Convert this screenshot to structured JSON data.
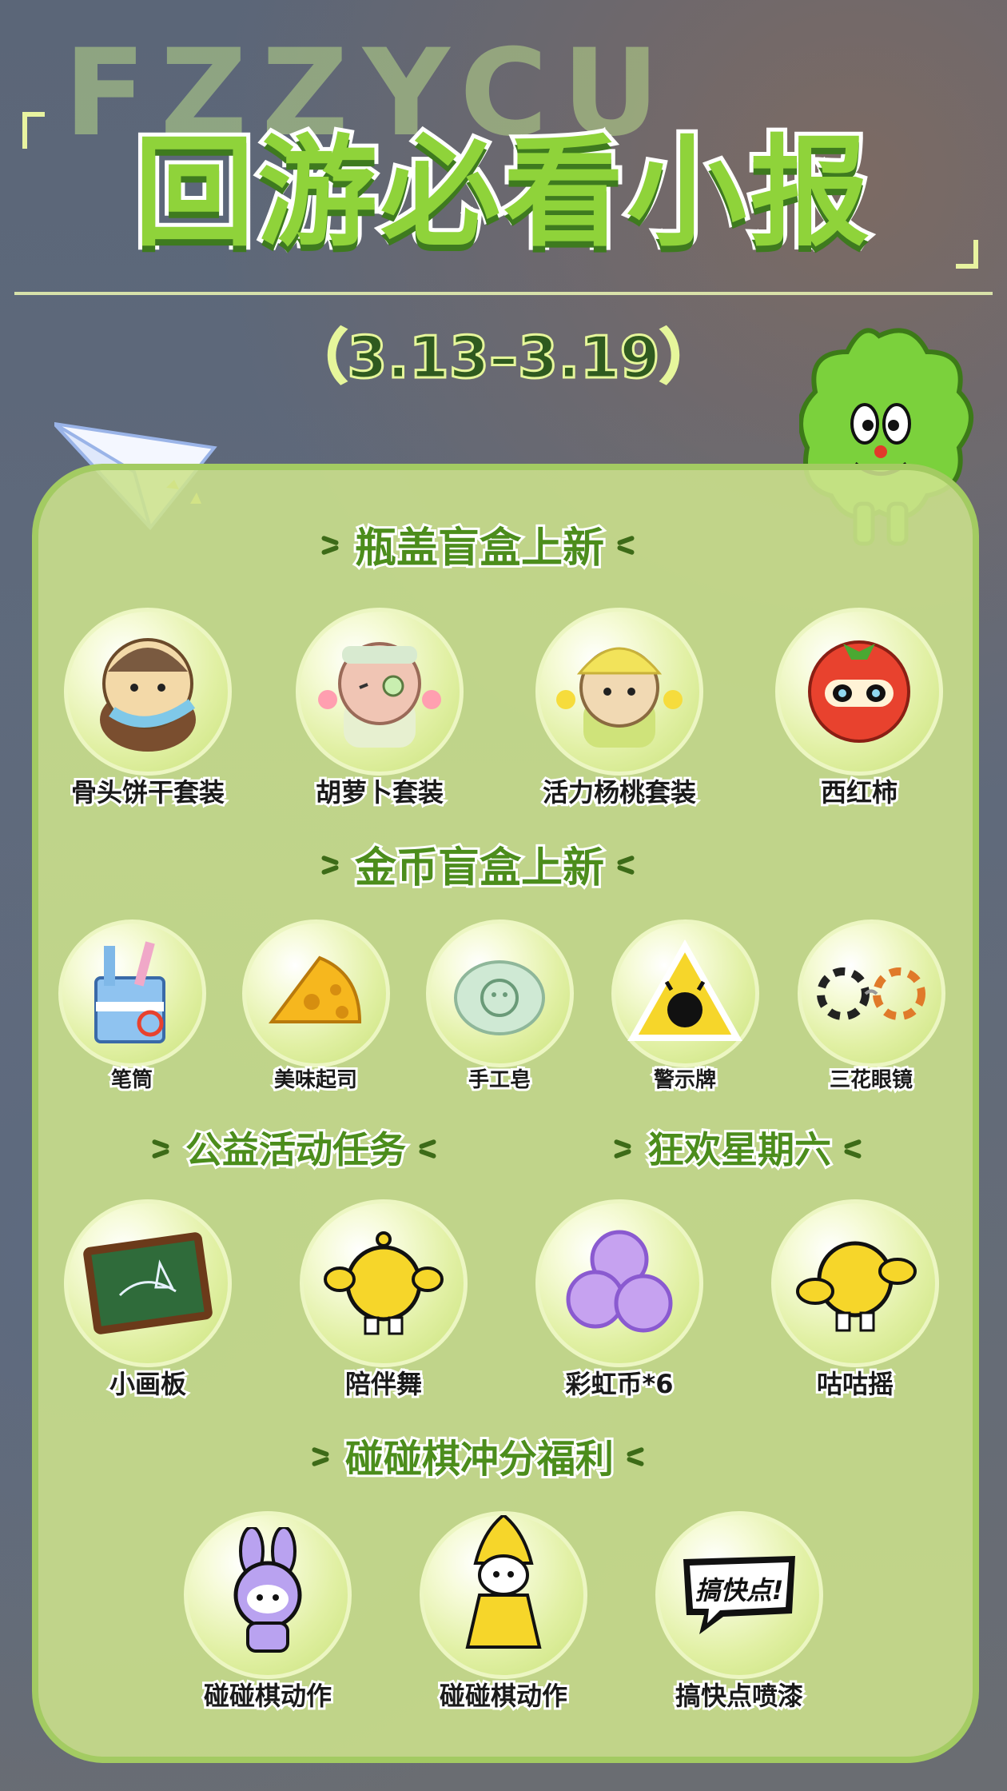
{
  "background_letters": "FZZYCU",
  "title": "回游必看小报",
  "date": "（3.13–3.19）",
  "colors": {
    "accent": "#8fd33a",
    "panel": "#cde28c",
    "border": "#a3cb62",
    "dark_green": "#4c8d1c"
  },
  "sections": {
    "bottlecap": {
      "title": "瓶盖盲盒上新",
      "items": [
        {
          "label": "骨头饼干套装",
          "icon": "bone-cookie-outfit-icon"
        },
        {
          "label": "胡萝卜套装",
          "icon": "carrot-outfit-icon"
        },
        {
          "label": "活力杨桃套装",
          "icon": "starfruit-outfit-icon"
        },
        {
          "label": "西红柿",
          "icon": "tomato-outfit-icon"
        }
      ]
    },
    "coin": {
      "title": "金币盲盒上新",
      "items": [
        {
          "label": "笔筒",
          "icon": "pen-holder-icon"
        },
        {
          "label": "美味起司",
          "icon": "cheese-icon"
        },
        {
          "label": "手工皂",
          "icon": "soap-icon"
        },
        {
          "label": "警示牌",
          "icon": "warning-sign-icon"
        },
        {
          "label": "三花眼镜",
          "icon": "glasses-icon"
        }
      ]
    },
    "charity": {
      "title": "公益活动任务",
      "items": [
        {
          "label": "小画板",
          "icon": "chalkboard-icon"
        },
        {
          "label": "陪伴舞",
          "icon": "dance-emote-icon"
        }
      ]
    },
    "saturday": {
      "title": "狂欢星期六",
      "items": [
        {
          "label": "彩虹币*6",
          "icon": "rainbow-coin-icon"
        },
        {
          "label": "咕咕摇",
          "icon": "shake-emote-icon"
        }
      ]
    },
    "chess": {
      "title": "碰碰棋冲分福利",
      "items": [
        {
          "label": "碰碰棋动作",
          "icon": "bunny-action-icon"
        },
        {
          "label": "碰碰棋动作",
          "icon": "raincoat-action-icon"
        },
        {
          "label": "搞快点喷漆",
          "icon": "spray-sticker-icon"
        }
      ],
      "spray_text": "搞快点!"
    }
  }
}
